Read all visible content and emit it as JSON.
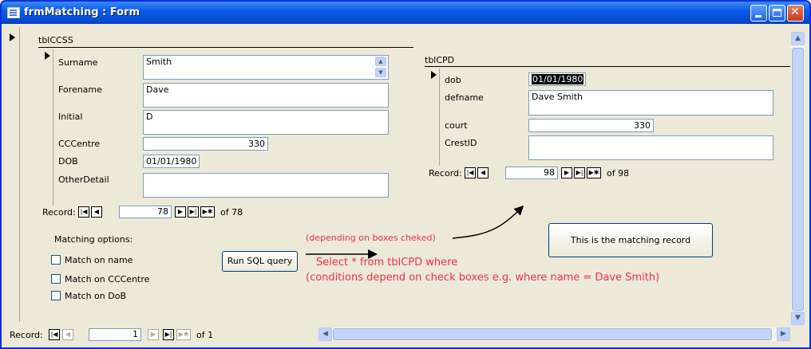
{
  "window": {
    "title": "frmMatching : Form"
  },
  "ccss": {
    "title": "tblCCSS",
    "fields": {
      "surname_label": "Surname",
      "surname_value": "Smith",
      "forename_label": "Forename",
      "forename_value": "Dave",
      "initial_label": "Initial",
      "initial_value": "D",
      "cccentre_label": "CCCentre",
      "cccentre_value": "330",
      "dob_label": "DOB",
      "dob_value": "01/01/1980",
      "otherdetail_label": "OtherDetail",
      "otherdetail_value": ""
    },
    "nav": {
      "label": "Record:",
      "current": "78",
      "of": "of 78"
    }
  },
  "cpd": {
    "title": "tblCPD",
    "fields": {
      "dob_label": "dob",
      "dob_value": "01/01/1980",
      "defname_label": "defname",
      "defname_value": "Dave Smith",
      "court_label": "court",
      "court_value": "330",
      "crestid_label": "CrestID",
      "crestid_value": ""
    },
    "nav": {
      "label": "Record:",
      "current": "98",
      "of": "of 98"
    }
  },
  "matching": {
    "heading": "Matching options:",
    "options": [
      "Match on name",
      "Match on CCCentre",
      "Match on DoB"
    ]
  },
  "run_button": "Run SQL query",
  "matching_record_button": "This is the matching record",
  "annotations": {
    "depending": "(depending on boxes cheked)",
    "select": "Select * from tblCPD where",
    "conditions": "(conditions depend on check boxes e.g. where name = Dave Smith)"
  },
  "form_nav": {
    "label": "Record:",
    "current": "1",
    "of": "of 1"
  },
  "colors": {
    "annotation": "#e8334a",
    "titlebar": "#0d5ae8"
  }
}
